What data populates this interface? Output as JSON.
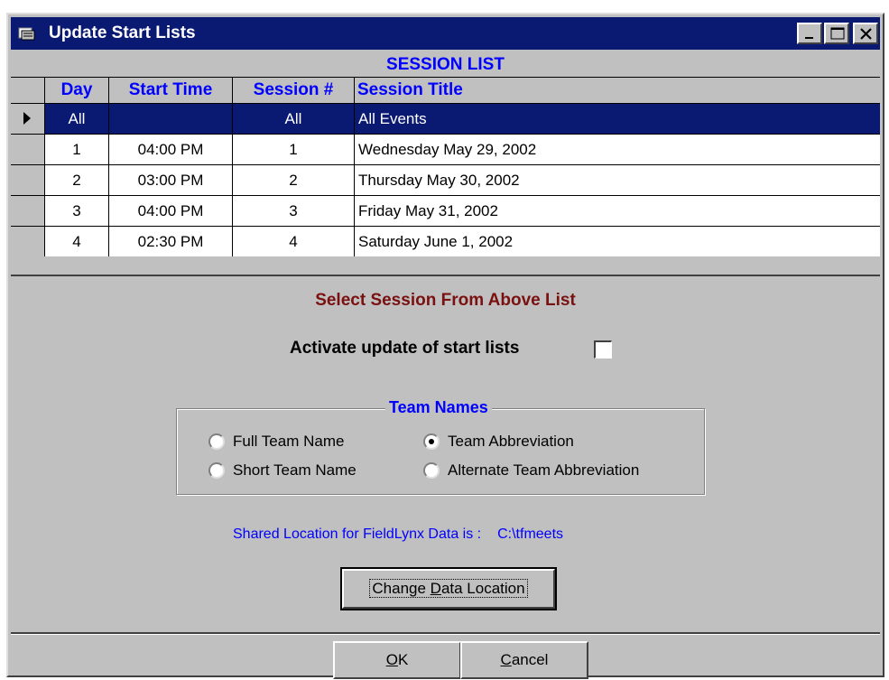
{
  "window": {
    "title": "Update Start Lists",
    "controls": {
      "minimize": "minimize-icon",
      "maximize": "maximize-icon",
      "close": "close-icon"
    }
  },
  "session_list": {
    "caption": "SESSION LIST",
    "columns": {
      "day": "Day",
      "start_time": "Start Time",
      "session": "Session #",
      "title": "Session Title"
    },
    "rows": [
      {
        "day": "All",
        "start_time": "",
        "session": "All",
        "title": "All Events",
        "selected": true
      },
      {
        "day": "1",
        "start_time": "04:00 PM",
        "session": "1",
        "title": "Wednesday May 29, 2002"
      },
      {
        "day": "2",
        "start_time": "03:00 PM",
        "session": "2",
        "title": "Thursday May 30, 2002"
      },
      {
        "day": "3",
        "start_time": "04:00 PM",
        "session": "3",
        "title": "Friday May 31, 2002"
      },
      {
        "day": "4",
        "start_time": "02:30 PM",
        "session": "4",
        "title": "Saturday  June 1, 2002"
      }
    ]
  },
  "prompt": "Select Session From Above List",
  "activate": {
    "label": "Activate update of start lists",
    "checked": false
  },
  "team_names": {
    "legend": "Team Names",
    "options": [
      {
        "label": "Full Team Name",
        "selected": false
      },
      {
        "label": "Team Abbreviation",
        "selected": true
      },
      {
        "label": "Short Team Name",
        "selected": false
      },
      {
        "label": "Alternate Team Abbreviation",
        "selected": false
      }
    ]
  },
  "shared_location": {
    "label": "Shared Location for FieldLynx Data is :",
    "path": "C:\\tfmeets"
  },
  "buttons": {
    "change_location": {
      "pre": "Change ",
      "underlined": "D",
      "post": "ata Location"
    },
    "ok": {
      "underlined": "O",
      "post": "K"
    },
    "cancel": {
      "underlined": "C",
      "post": "ancel"
    }
  },
  "colors": {
    "title_bar": "#0a1a72",
    "header_text": "#0000ff",
    "prompt_text": "#7a1010",
    "face": "#c0c0c0"
  }
}
